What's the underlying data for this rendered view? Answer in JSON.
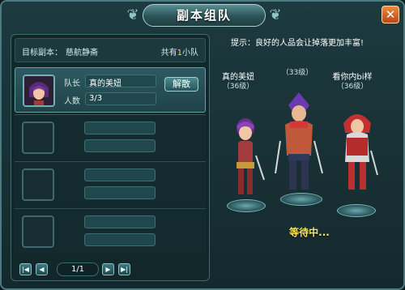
{
  "window": {
    "title": "副本组队",
    "close_icon": "✕"
  },
  "info": {
    "target_label": "目标副本：",
    "target_name": "慈航静斋",
    "team_count_prefix": "共有",
    "team_count_num": "1",
    "team_count_suffix": "小队"
  },
  "slots": [
    {
      "leader_label": "队长",
      "leader_name": "真的美妞",
      "count_label": "人数",
      "count_value": "3/3",
      "disband_label": "解散"
    }
  ],
  "pager": {
    "first_icon": "|◀",
    "prev_icon": "◀",
    "page": "1/1",
    "next_icon": "▶",
    "last_icon": "▶|"
  },
  "hint": "提示：良好的人品会让掉落更加丰富!",
  "heroes": [
    {
      "name": "真的美妞",
      "level": "（36级）"
    },
    {
      "name": "",
      "level": "（33级）"
    },
    {
      "name": "看你内bi样",
      "level": "（36级）"
    }
  ],
  "status": "等待中...",
  "colors": {
    "accent": "#ffd65a",
    "waiting": "#f8e85a",
    "close": "#d9642a"
  }
}
